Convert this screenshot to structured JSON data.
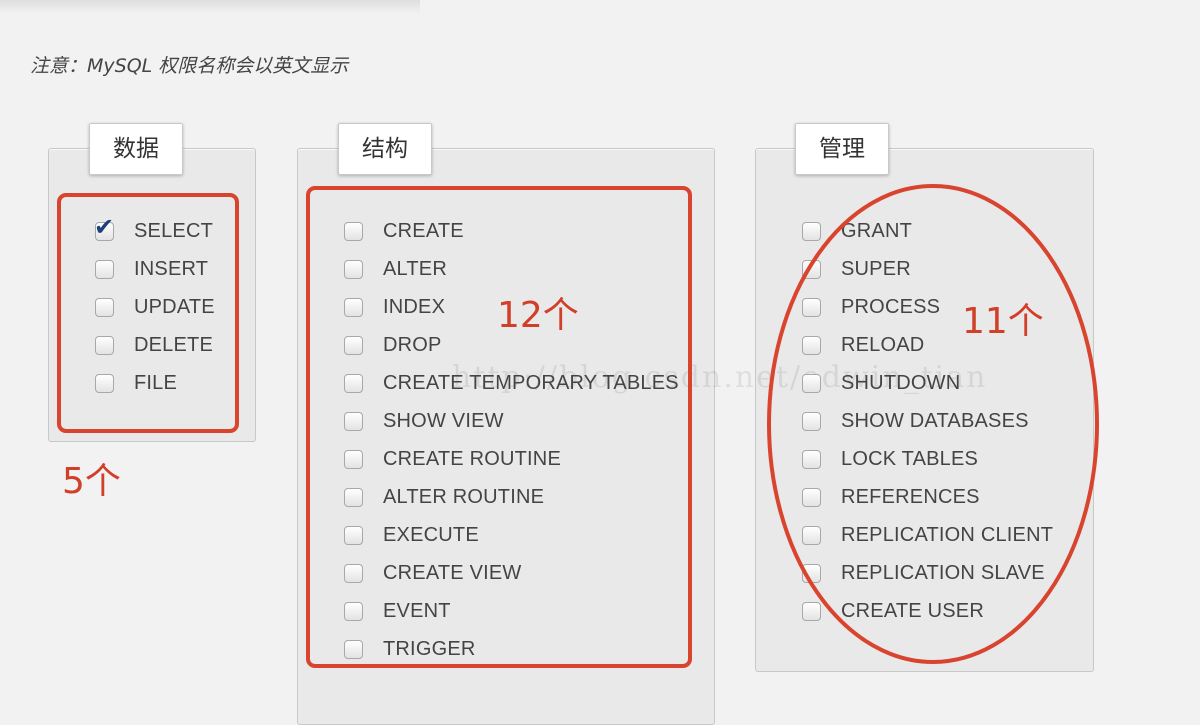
{
  "note": "注意：MySQL 权限名称会以英文显示",
  "panels": {
    "data": {
      "title": "数据",
      "count": "5个",
      "items": [
        {
          "label": "SELECT",
          "checked": true
        },
        {
          "label": "INSERT",
          "checked": false
        },
        {
          "label": "UPDATE",
          "checked": false
        },
        {
          "label": "DELETE",
          "checked": false
        },
        {
          "label": "FILE",
          "checked": false
        }
      ]
    },
    "structure": {
      "title": "结构",
      "count": "12个",
      "items": [
        {
          "label": "CREATE",
          "checked": false
        },
        {
          "label": "ALTER",
          "checked": false
        },
        {
          "label": "INDEX",
          "checked": false
        },
        {
          "label": "DROP",
          "checked": false
        },
        {
          "label": "CREATE TEMPORARY TABLES",
          "checked": false
        },
        {
          "label": "SHOW VIEW",
          "checked": false
        },
        {
          "label": "CREATE ROUTINE",
          "checked": false
        },
        {
          "label": "ALTER ROUTINE",
          "checked": false
        },
        {
          "label": "EXECUTE",
          "checked": false
        },
        {
          "label": "CREATE VIEW",
          "checked": false
        },
        {
          "label": "EVENT",
          "checked": false
        },
        {
          "label": "TRIGGER",
          "checked": false
        }
      ]
    },
    "admin": {
      "title": "管理",
      "count": "11个",
      "items": [
        {
          "label": "GRANT",
          "checked": false
        },
        {
          "label": "SUPER",
          "checked": false
        },
        {
          "label": "PROCESS",
          "checked": false
        },
        {
          "label": "RELOAD",
          "checked": false
        },
        {
          "label": "SHUTDOWN",
          "checked": false
        },
        {
          "label": "SHOW DATABASES",
          "checked": false
        },
        {
          "label": "LOCK TABLES",
          "checked": false
        },
        {
          "label": "REFERENCES",
          "checked": false
        },
        {
          "label": "REPLICATION CLIENT",
          "checked": false
        },
        {
          "label": "REPLICATION SLAVE",
          "checked": false
        },
        {
          "label": "CREATE USER",
          "checked": false
        }
      ]
    }
  },
  "watermark": "http://blog.csdn.net/edwin_tian",
  "colors": {
    "annotation_red": "#d9442f",
    "checkmark": "#1d3f7a"
  }
}
